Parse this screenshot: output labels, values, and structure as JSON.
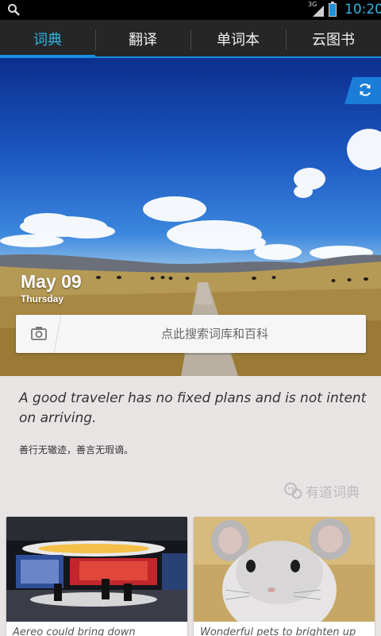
{
  "status_bar": {
    "network": "3G",
    "time": "10:20",
    "icons": [
      "search-icon",
      "signal-icon",
      "battery-icon"
    ]
  },
  "tabs": [
    {
      "label": "词典",
      "active": true
    },
    {
      "label": "翻译",
      "active": false
    },
    {
      "label": "单词本",
      "active": false
    },
    {
      "label": "云图书",
      "active": false
    }
  ],
  "hero": {
    "date": "May 09",
    "weekday": "Thursday",
    "refresh_icon": "refresh-icon"
  },
  "search": {
    "placeholder": "点此搜索词库和百科",
    "icon": "camera-icon"
  },
  "quote": {
    "english": "A good traveler has no fixed plans and is not intent on arriving.",
    "chinese": "善行无辙迹，善言无瑕谪。"
  },
  "brand": {
    "name": "有道词典"
  },
  "cards": [
    {
      "caption": "Aereo could bring down"
    },
    {
      "caption": "Wonderful pets to brighten up"
    }
  ],
  "colors": {
    "accent": "#33b5e5",
    "tab_bar": "#262626",
    "indicator": "#1a8fe0",
    "background": "#e9e4e4"
  }
}
